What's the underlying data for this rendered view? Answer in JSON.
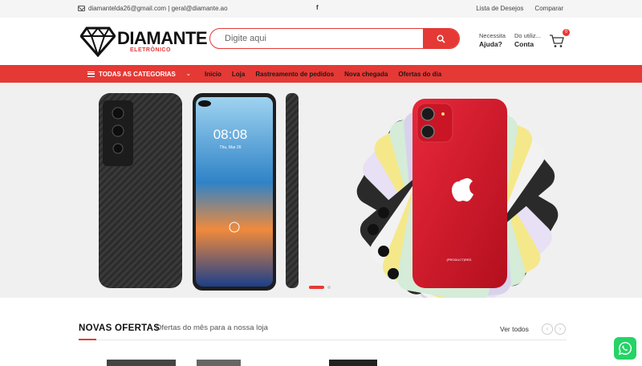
{
  "topbar": {
    "email_text": "diamantelda26@gmail.com | geral@diamante.ao",
    "facebook_glyph": "f",
    "wishlist_label": "Lista de Desejos",
    "compare_label": "Comparar"
  },
  "header": {
    "logo_brand": "DIAMANTE",
    "logo_sub": "ELETRÔNICO",
    "search_placeholder": "Digite aqui",
    "help_top": "Necessita",
    "help_bottom": "Ajuda?",
    "account_top": "Do utiliz...",
    "account_bottom": "Conta",
    "cart_count": "0"
  },
  "nav": {
    "categories_label": "TODAS AS CATEGORIAS",
    "items": [
      "Inicio",
      "Loja",
      "Rastreamento de pedidos",
      "Nova chegada",
      "Ofertas do dia"
    ]
  },
  "hero": {
    "phone_time": "08:08",
    "phone_date": "Thu, Mar 26",
    "product_red_label": "(PRODUCT)RED",
    "slide_count": 2,
    "active_slide": 1
  },
  "section": {
    "title": "NOVAS OFERTAS",
    "subtitle": "Ofertas do mês para a nossa loja",
    "view_all": "Ver todos"
  },
  "colors": {
    "accent": "#e53935",
    "whatsapp": "#25d366"
  }
}
